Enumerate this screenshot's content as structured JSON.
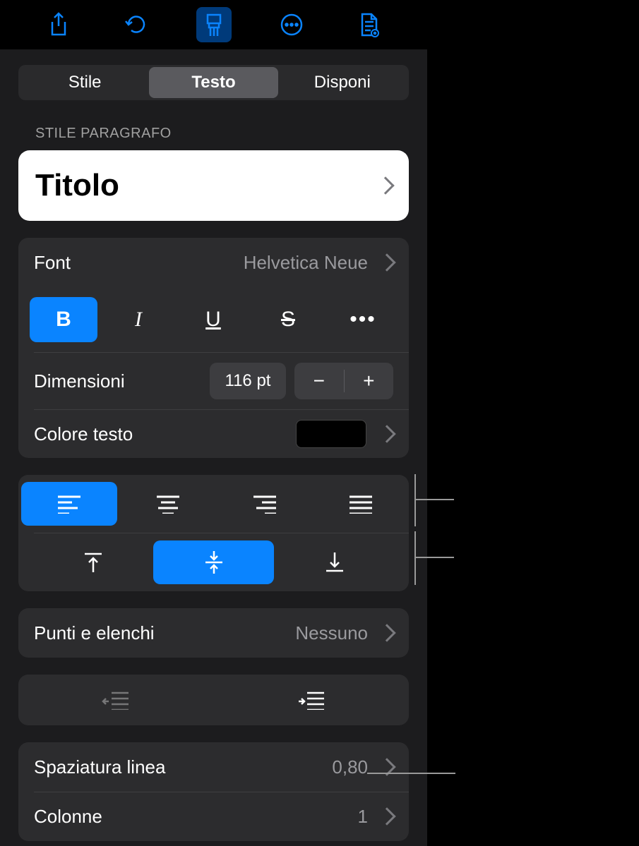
{
  "toolbar": {
    "share": "share-icon",
    "undo": "undo-icon",
    "format": "format-brush-icon",
    "more": "more-circle-icon",
    "insert": "insert-icon"
  },
  "tabs": {
    "style": "Stile",
    "text": "Testo",
    "arrange": "Disponi"
  },
  "paragraphStyle": {
    "section_label": "STILE PARAGRAFO",
    "value": "Titolo"
  },
  "font": {
    "label": "Font",
    "value": "Helvetica Neue"
  },
  "textStyles": {
    "bold": "B",
    "italic": "I",
    "underline": "U",
    "strike": "S",
    "more": "•••"
  },
  "size": {
    "label": "Dimensioni",
    "value": "116 pt",
    "minus": "−",
    "plus": "+"
  },
  "textColor": {
    "label": "Colore testo",
    "swatch": "#000000"
  },
  "bullets": {
    "label": "Punti e elenchi",
    "value": "Nessuno"
  },
  "lineSpacing": {
    "label": "Spaziatura linea",
    "value": "0,80"
  },
  "columns": {
    "label": "Colonne",
    "value": "1"
  }
}
